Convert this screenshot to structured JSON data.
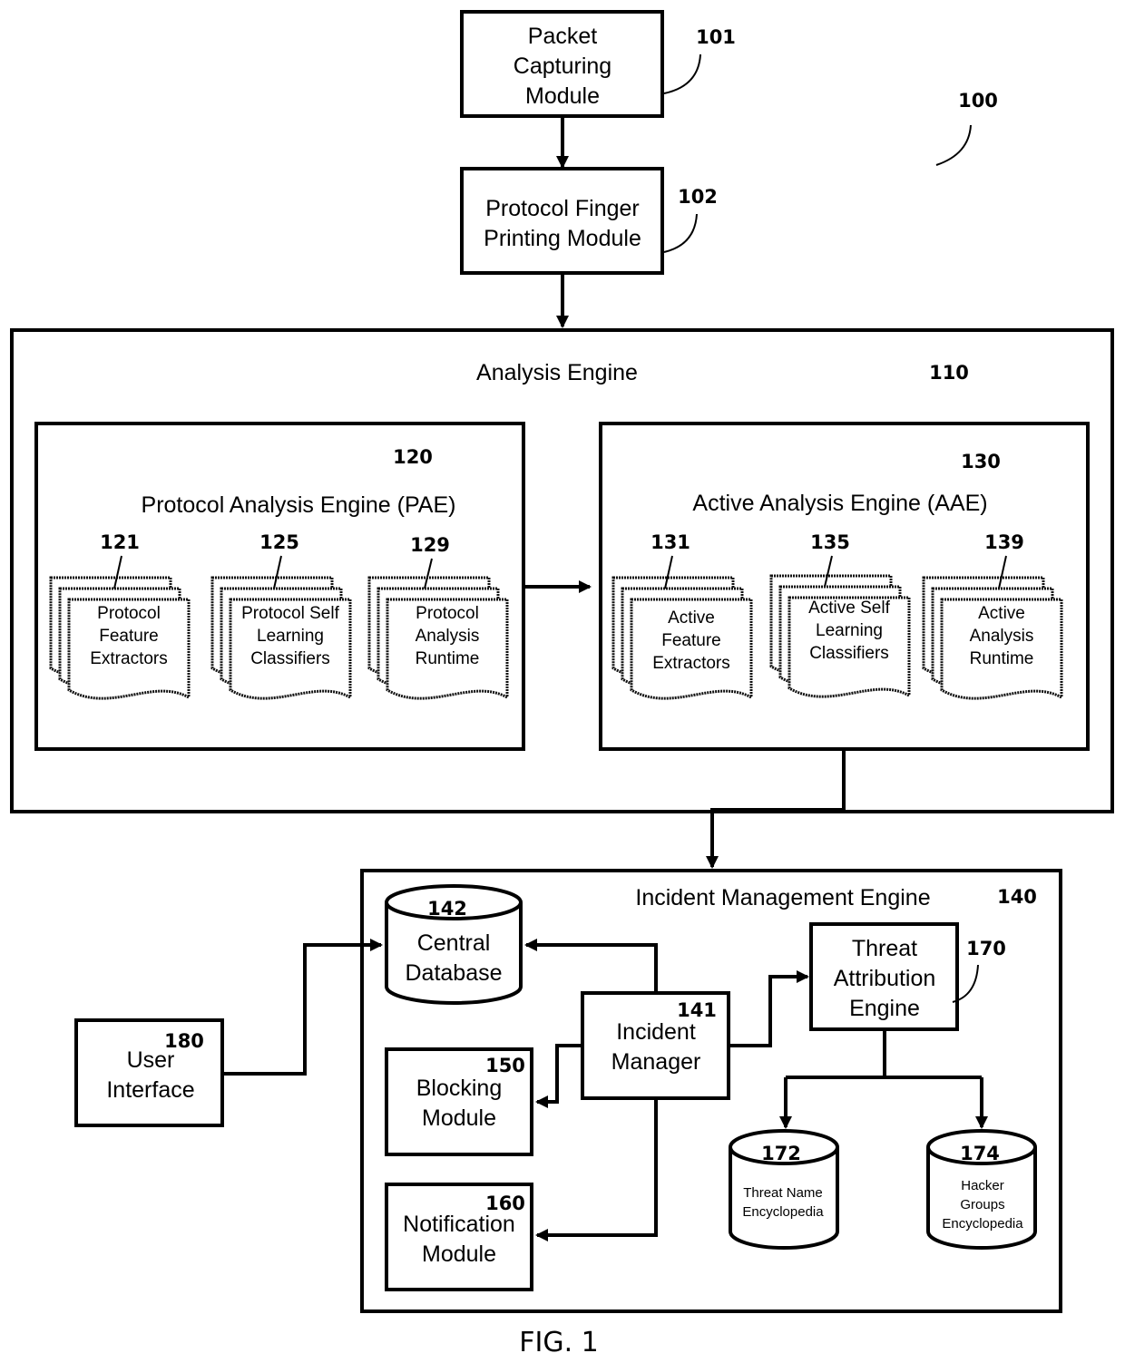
{
  "system_ref": "100",
  "figure_label": "FIG. 1",
  "packet_capturing": {
    "ref": "101",
    "lines": [
      "Packet",
      "Capturing",
      "Module"
    ]
  },
  "protocol_fingerprinting": {
    "ref": "102",
    "lines": [
      "Protocol Finger",
      "Printing Module"
    ]
  },
  "analysis_engine": {
    "ref": "110",
    "title": "Analysis Engine"
  },
  "pae": {
    "ref": "120",
    "title": "Protocol Analysis Engine (PAE)",
    "docs": [
      {
        "ref": "121",
        "lines": [
          "Protocol",
          "Feature",
          "Extractors"
        ]
      },
      {
        "ref": "125",
        "lines": [
          "Protocol Self",
          "Learning",
          "Classifiers"
        ]
      },
      {
        "ref": "129",
        "lines": [
          "Protocol",
          "Analysis",
          "Runtime"
        ]
      }
    ]
  },
  "aae": {
    "ref": "130",
    "title": "Active Analysis Engine (AAE)",
    "docs": [
      {
        "ref": "131",
        "lines": [
          "Active",
          "Feature",
          "Extractors"
        ]
      },
      {
        "ref": "135",
        "lines": [
          "Active Self",
          "Learning",
          "Classifiers"
        ]
      },
      {
        "ref": "139",
        "lines": [
          "Active",
          "Analysis",
          "Runtime"
        ]
      }
    ]
  },
  "incident_engine": {
    "ref": "140",
    "title": "Incident Management Engine"
  },
  "incident_manager": {
    "ref": "141",
    "lines": [
      "Incident",
      "Manager"
    ]
  },
  "central_database": {
    "ref": "142",
    "lines": [
      "Central",
      "Database"
    ]
  },
  "blocking_module": {
    "ref": "150",
    "lines": [
      "Blocking",
      "Module"
    ]
  },
  "notification_module": {
    "ref": "160",
    "lines": [
      "Notification",
      "Module"
    ]
  },
  "threat_attribution": {
    "ref": "170",
    "lines": [
      "Threat",
      "Attribution",
      "Engine"
    ]
  },
  "threat_name_db": {
    "ref": "172",
    "lines": [
      "Threat Name",
      "Encyclopedia"
    ]
  },
  "hacker_groups_db": {
    "ref": "174",
    "lines": [
      "Hacker",
      "Groups",
      "Encyclopedia"
    ]
  },
  "user_interface": {
    "ref": "180",
    "lines": [
      "User",
      "Interface"
    ]
  }
}
